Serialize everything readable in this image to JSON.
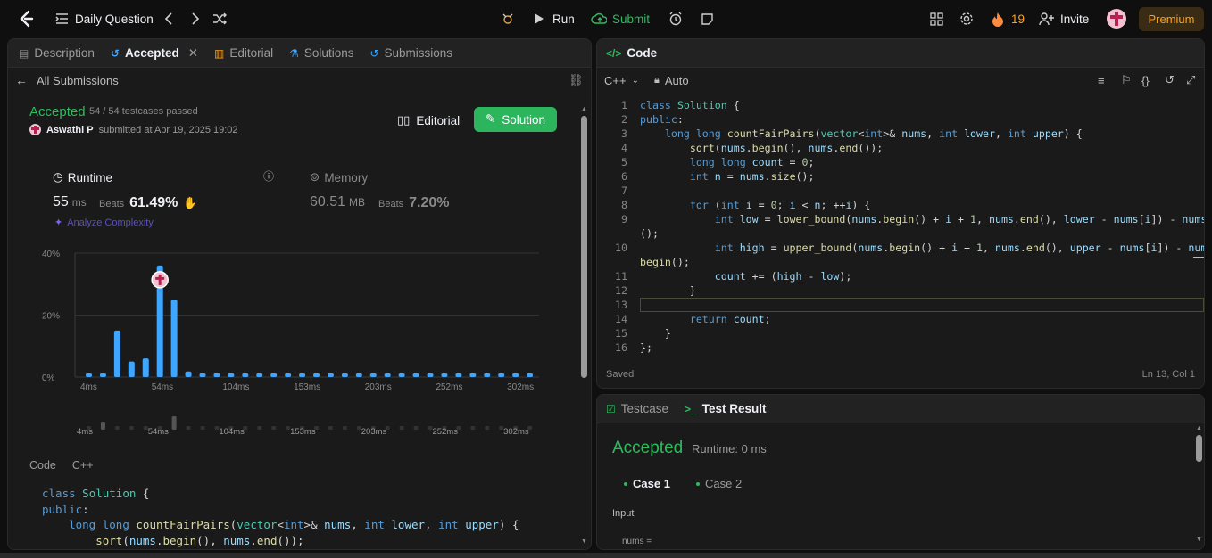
{
  "topbar": {
    "title": "Daily Question",
    "run": "Run",
    "submit": "Submit",
    "streak": "19",
    "invite": "Invite",
    "premium": "Premium"
  },
  "left_tabs": [
    "Description",
    "Accepted",
    "Editorial",
    "Solutions",
    "Submissions"
  ],
  "left": {
    "back": "All Submissions",
    "status": "Accepted",
    "testcases": "54 / 54 testcases passed",
    "user": "Aswathi P",
    "submitted": "submitted at Apr 19, 2025 19:02",
    "editorial_btn": "Editorial",
    "solution_btn": "Solution",
    "runtime_label": "Runtime",
    "runtime_value": "55",
    "runtime_unit": "ms",
    "beats_label": "Beats",
    "runtime_beats": "61.49%",
    "analyze": "Analyze Complexity",
    "memory_label": "Memory",
    "memory_value": "60.51",
    "memory_unit": "MB",
    "memory_beats": "7.20%",
    "code_tab": "Code",
    "lang_tab": "C++"
  },
  "chart_data": {
    "type": "bar",
    "ylim": [
      0,
      40
    ],
    "y_ticks": [
      "40%",
      "20%",
      "0%"
    ],
    "x_ticks": [
      "4ms",
      "54ms",
      "104ms",
      "153ms",
      "203ms",
      "252ms",
      "302ms"
    ],
    "values": [
      1.2,
      1.2,
      15,
      5,
      6,
      36,
      25,
      1.8,
      1.2,
      1.2,
      1.2,
      1.2,
      1.2,
      1.2,
      1.2,
      1.2,
      1.2,
      1.2,
      1.2,
      1.2,
      1.2,
      1.2,
      1.2,
      1.2,
      1.2,
      1.2,
      1.2,
      1.2,
      1.2,
      1.2,
      1.2,
      1.2
    ],
    "highlight_index": 5,
    "mini_x_ticks": [
      "4ms",
      "54ms",
      "104ms",
      "153ms",
      "203ms",
      "252ms",
      "302ms"
    ],
    "mini_values": [
      0,
      3,
      0,
      0,
      0,
      0,
      5,
      0,
      0,
      0,
      0,
      0,
      0,
      0,
      0,
      0,
      0,
      0,
      0,
      0,
      0,
      0,
      0,
      0,
      0,
      0,
      0,
      0,
      0,
      0,
      0,
      0
    ],
    "accent": "#3ea6ff"
  },
  "left_code": [
    "class Solution {",
    "public:",
    "    long long countFairPairs(vector<int>& nums, int lower, int upper) {",
    "        sort(nums.begin(), nums.end());"
  ],
  "editor": {
    "header": "Code",
    "lang": "C++",
    "mode": "Auto",
    "saved": "Saved",
    "cursor": "Ln 13, Col 1",
    "lines": [
      {
        "n": "1",
        "t": "class Solution {"
      },
      {
        "n": "2",
        "t": "public:"
      },
      {
        "n": "3",
        "t": "    long long countFairPairs(vector<int>& nums, int lower, int upper) {"
      },
      {
        "n": "4",
        "t": "        sort(nums.begin(), nums.end());"
      },
      {
        "n": "5",
        "t": "        long long count = 0;"
      },
      {
        "n": "6",
        "t": "        int n = nums.size();"
      },
      {
        "n": "7",
        "t": ""
      },
      {
        "n": "8",
        "t": "        for (int i = 0; i < n; ++i) {"
      },
      {
        "n": "9",
        "t": "            int low = lower_bound(nums.begin() + i + 1, nums.end(), lower - nums[i]) - nums.begin"
      },
      {
        "n": "",
        "t": "();"
      },
      {
        "n": "10",
        "t": "            int high = upper_bound(nums.begin() + i + 1, nums.end(), upper - nums[i]) - nums."
      },
      {
        "n": "",
        "t": "begin();"
      },
      {
        "n": "11",
        "t": "            count += (high - low);"
      },
      {
        "n": "12",
        "t": "        }"
      },
      {
        "n": "13",
        "t": ""
      },
      {
        "n": "14",
        "t": "        return count;"
      },
      {
        "n": "15",
        "t": "    }"
      },
      {
        "n": "16",
        "t": "};"
      }
    ]
  },
  "result": {
    "tab_testcase": "Testcase",
    "tab_result": "Test Result",
    "status": "Accepted",
    "runtime": "Runtime: 0 ms",
    "case1": "Case 1",
    "case2": "Case 2",
    "input_label": "Input",
    "input_var": "nums ="
  }
}
